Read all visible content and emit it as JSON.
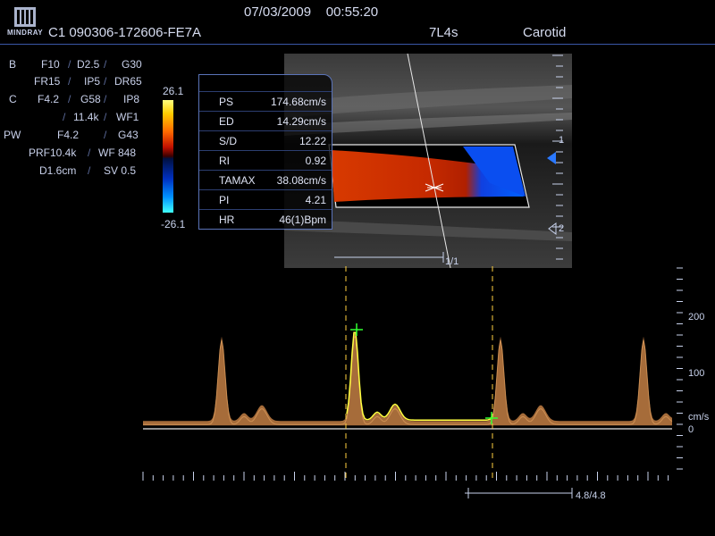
{
  "header": {
    "brand": "MINDRAY",
    "datetime": "07/03/2009    00:55:20",
    "patient_id": "C1 090306-172606-FE7A",
    "probe": "7L4s",
    "exam": "Carotid"
  },
  "params": {
    "b_mode": "B",
    "c_mode": "C",
    "pw_mode": "PW",
    "b1": [
      "F10",
      "D2.5",
      "G30"
    ],
    "b2": [
      "FR15",
      "IP5",
      "DR65"
    ],
    "c1": [
      "F4.2",
      "G58",
      "IP8"
    ],
    "c2": [
      "11.4k",
      "WF1"
    ],
    "pw1": [
      "F4.2",
      "G43"
    ],
    "pw2": [
      "PRF10.4k",
      "WF 848"
    ],
    "pw3": [
      "D1.6cm",
      "SV 0.5"
    ]
  },
  "color_bar": {
    "max": "26.1",
    "min": "-26.1"
  },
  "measurements": [
    {
      "label": "PS",
      "value": "174.68cm/s"
    },
    {
      "label": "ED",
      "value": "14.29cm/s"
    },
    {
      "label": "S/D",
      "value": "12.22"
    },
    {
      "label": "RI",
      "value": "0.92"
    },
    {
      "label": "TAMAX",
      "value": "38.08cm/s"
    },
    {
      "label": "PI",
      "value": "4.21"
    },
    {
      "label": "HR",
      "value": "46(1)Bpm"
    }
  ],
  "image_scale": {
    "depth_marks": [
      "1",
      "2"
    ],
    "frame": "1/1"
  },
  "spectrum": {
    "scale_labels": [
      "200",
      "100",
      "cm/s",
      "0"
    ],
    "cine": "4.8/4.8",
    "peak_velocity": 174.68,
    "end_diastolic_velocity": 14.29
  },
  "colors": {
    "accent": "#4a6fd0",
    "trace": "#ffff40",
    "caliper": "#30ff30"
  }
}
